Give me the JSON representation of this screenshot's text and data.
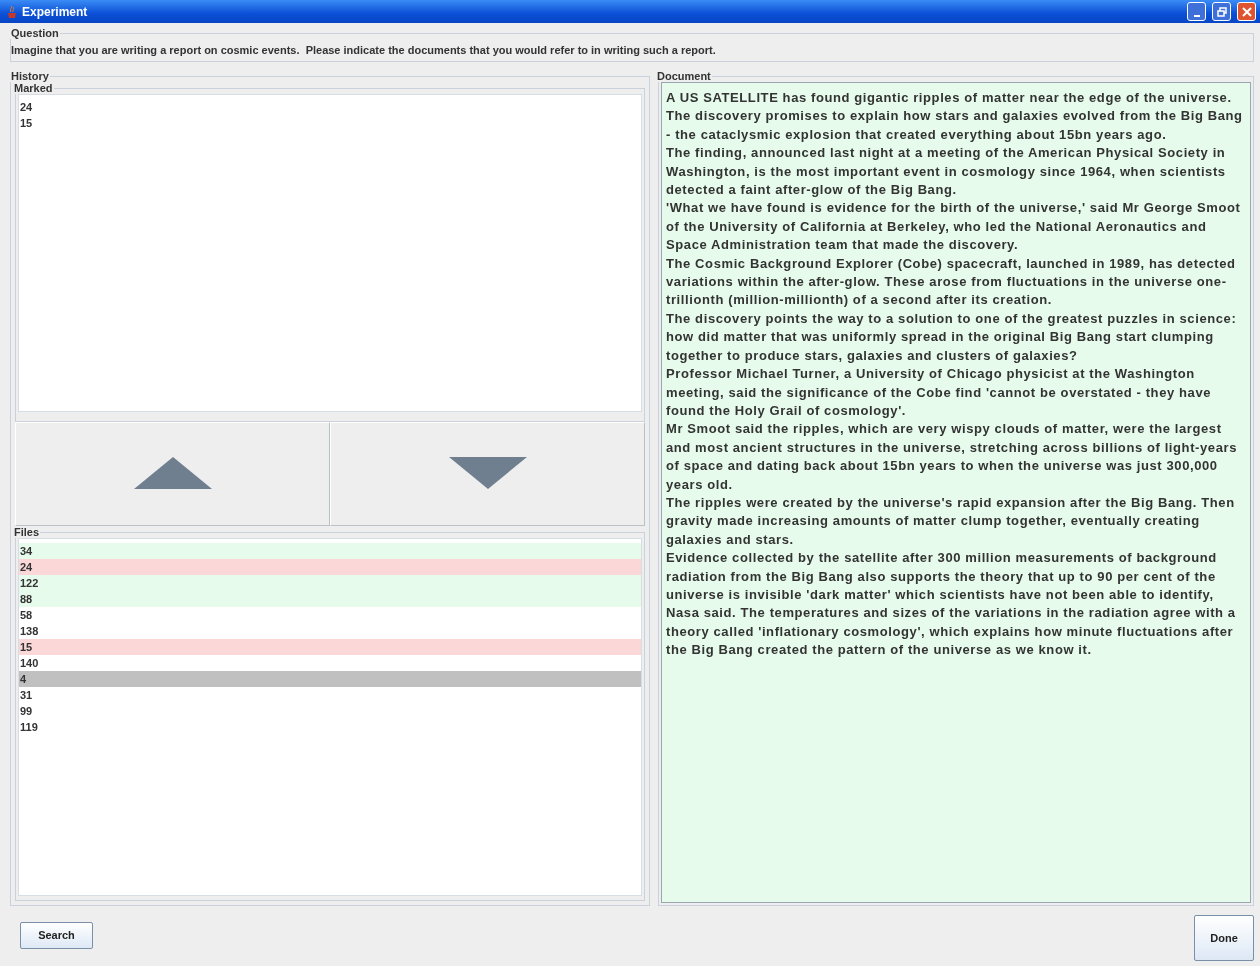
{
  "window": {
    "title": "Experiment"
  },
  "question": {
    "title": "Question",
    "text": "Imagine that you are writing a report on cosmic events.  Please indicate the documents that you would refer to in writing such a report."
  },
  "history": {
    "title": "History",
    "marked": {
      "title": "Marked",
      "items": [
        "24",
        "15"
      ]
    },
    "files": {
      "title": "Files",
      "items": [
        {
          "label": "34",
          "kind": "viewed",
          "selected": false
        },
        {
          "label": "24",
          "kind": "marked",
          "selected": false
        },
        {
          "label": "122",
          "kind": "viewed",
          "selected": false
        },
        {
          "label": "88",
          "kind": "viewed",
          "selected": false
        },
        {
          "label": "58",
          "kind": "plain",
          "selected": false
        },
        {
          "label": "138",
          "kind": "plain",
          "selected": false
        },
        {
          "label": "15",
          "kind": "marked",
          "selected": false
        },
        {
          "label": "140",
          "kind": "plain",
          "selected": false
        },
        {
          "label": "4",
          "selected": true
        },
        {
          "label": "31",
          "kind": "plain",
          "selected": false
        },
        {
          "label": "99",
          "kind": "plain",
          "selected": false
        },
        {
          "label": "119",
          "kind": "plain",
          "selected": false
        }
      ]
    }
  },
  "document": {
    "title": "Document",
    "paragraphs": [
      "A US SATELLITE has found gigantic ripples of matter near the edge of the universe. The discovery promises to explain how stars and galaxies evolved from the Big Bang - the cataclysmic explosion that created everything about 15bn years ago.",
      "The finding, announced last night at a meeting of the American Physical Society in Washington, is the most important event in cosmology since 1964, when scientists detected a faint after-glow of the Big Bang.",
      "'What we have found is evidence for the birth of the universe,' said Mr George Smoot of the University of California at Berkeley, who led the National Aeronautics and Space Administration team that made the discovery.",
      "The Cosmic Background Explorer (Cobe) spacecraft, launched in 1989, has detected variations within the after-glow. These arose from fluctuations in the universe one-trillionth (million-millionth) of a second after its creation.",
      "The discovery points the way to a solution to one of the greatest puzzles in science: how did matter that was uniformly spread in the original Big Bang start clumping together to produce stars, galaxies and clusters of galaxies?",
      "Professor Michael Turner, a University of Chicago physicist at the Washington meeting, said the significance of the Cobe find 'cannot be overstated - they have found the Holy Grail of cosmology'.",
      "Mr Smoot said the ripples, which are very wispy clouds of matter, were the largest and most ancient structures in the universe, stretching across billions of light-years of space and dating back about 15bn years to when the universe was just 300,000 years old.",
      "The ripples were created by the universe's rapid expansion after the Big Bang. Then gravity made increasing amounts of matter clump together, eventually creating galaxies and stars.",
      "Evidence collected by the satellite after 300 million measurements of background radiation from the Big Bang also supports the theory that up to 90 per cent of the universe is invisible 'dark matter' which scientists have not been able to identify, Nasa said. The temperatures and sizes of the variations in the radiation agree with a theory called 'inflationary cosmology', which explains how minute fluctuations after the Big Bang created the pattern of the universe as we know it."
    ]
  },
  "buttons": {
    "search": "Search",
    "done": "Done"
  }
}
